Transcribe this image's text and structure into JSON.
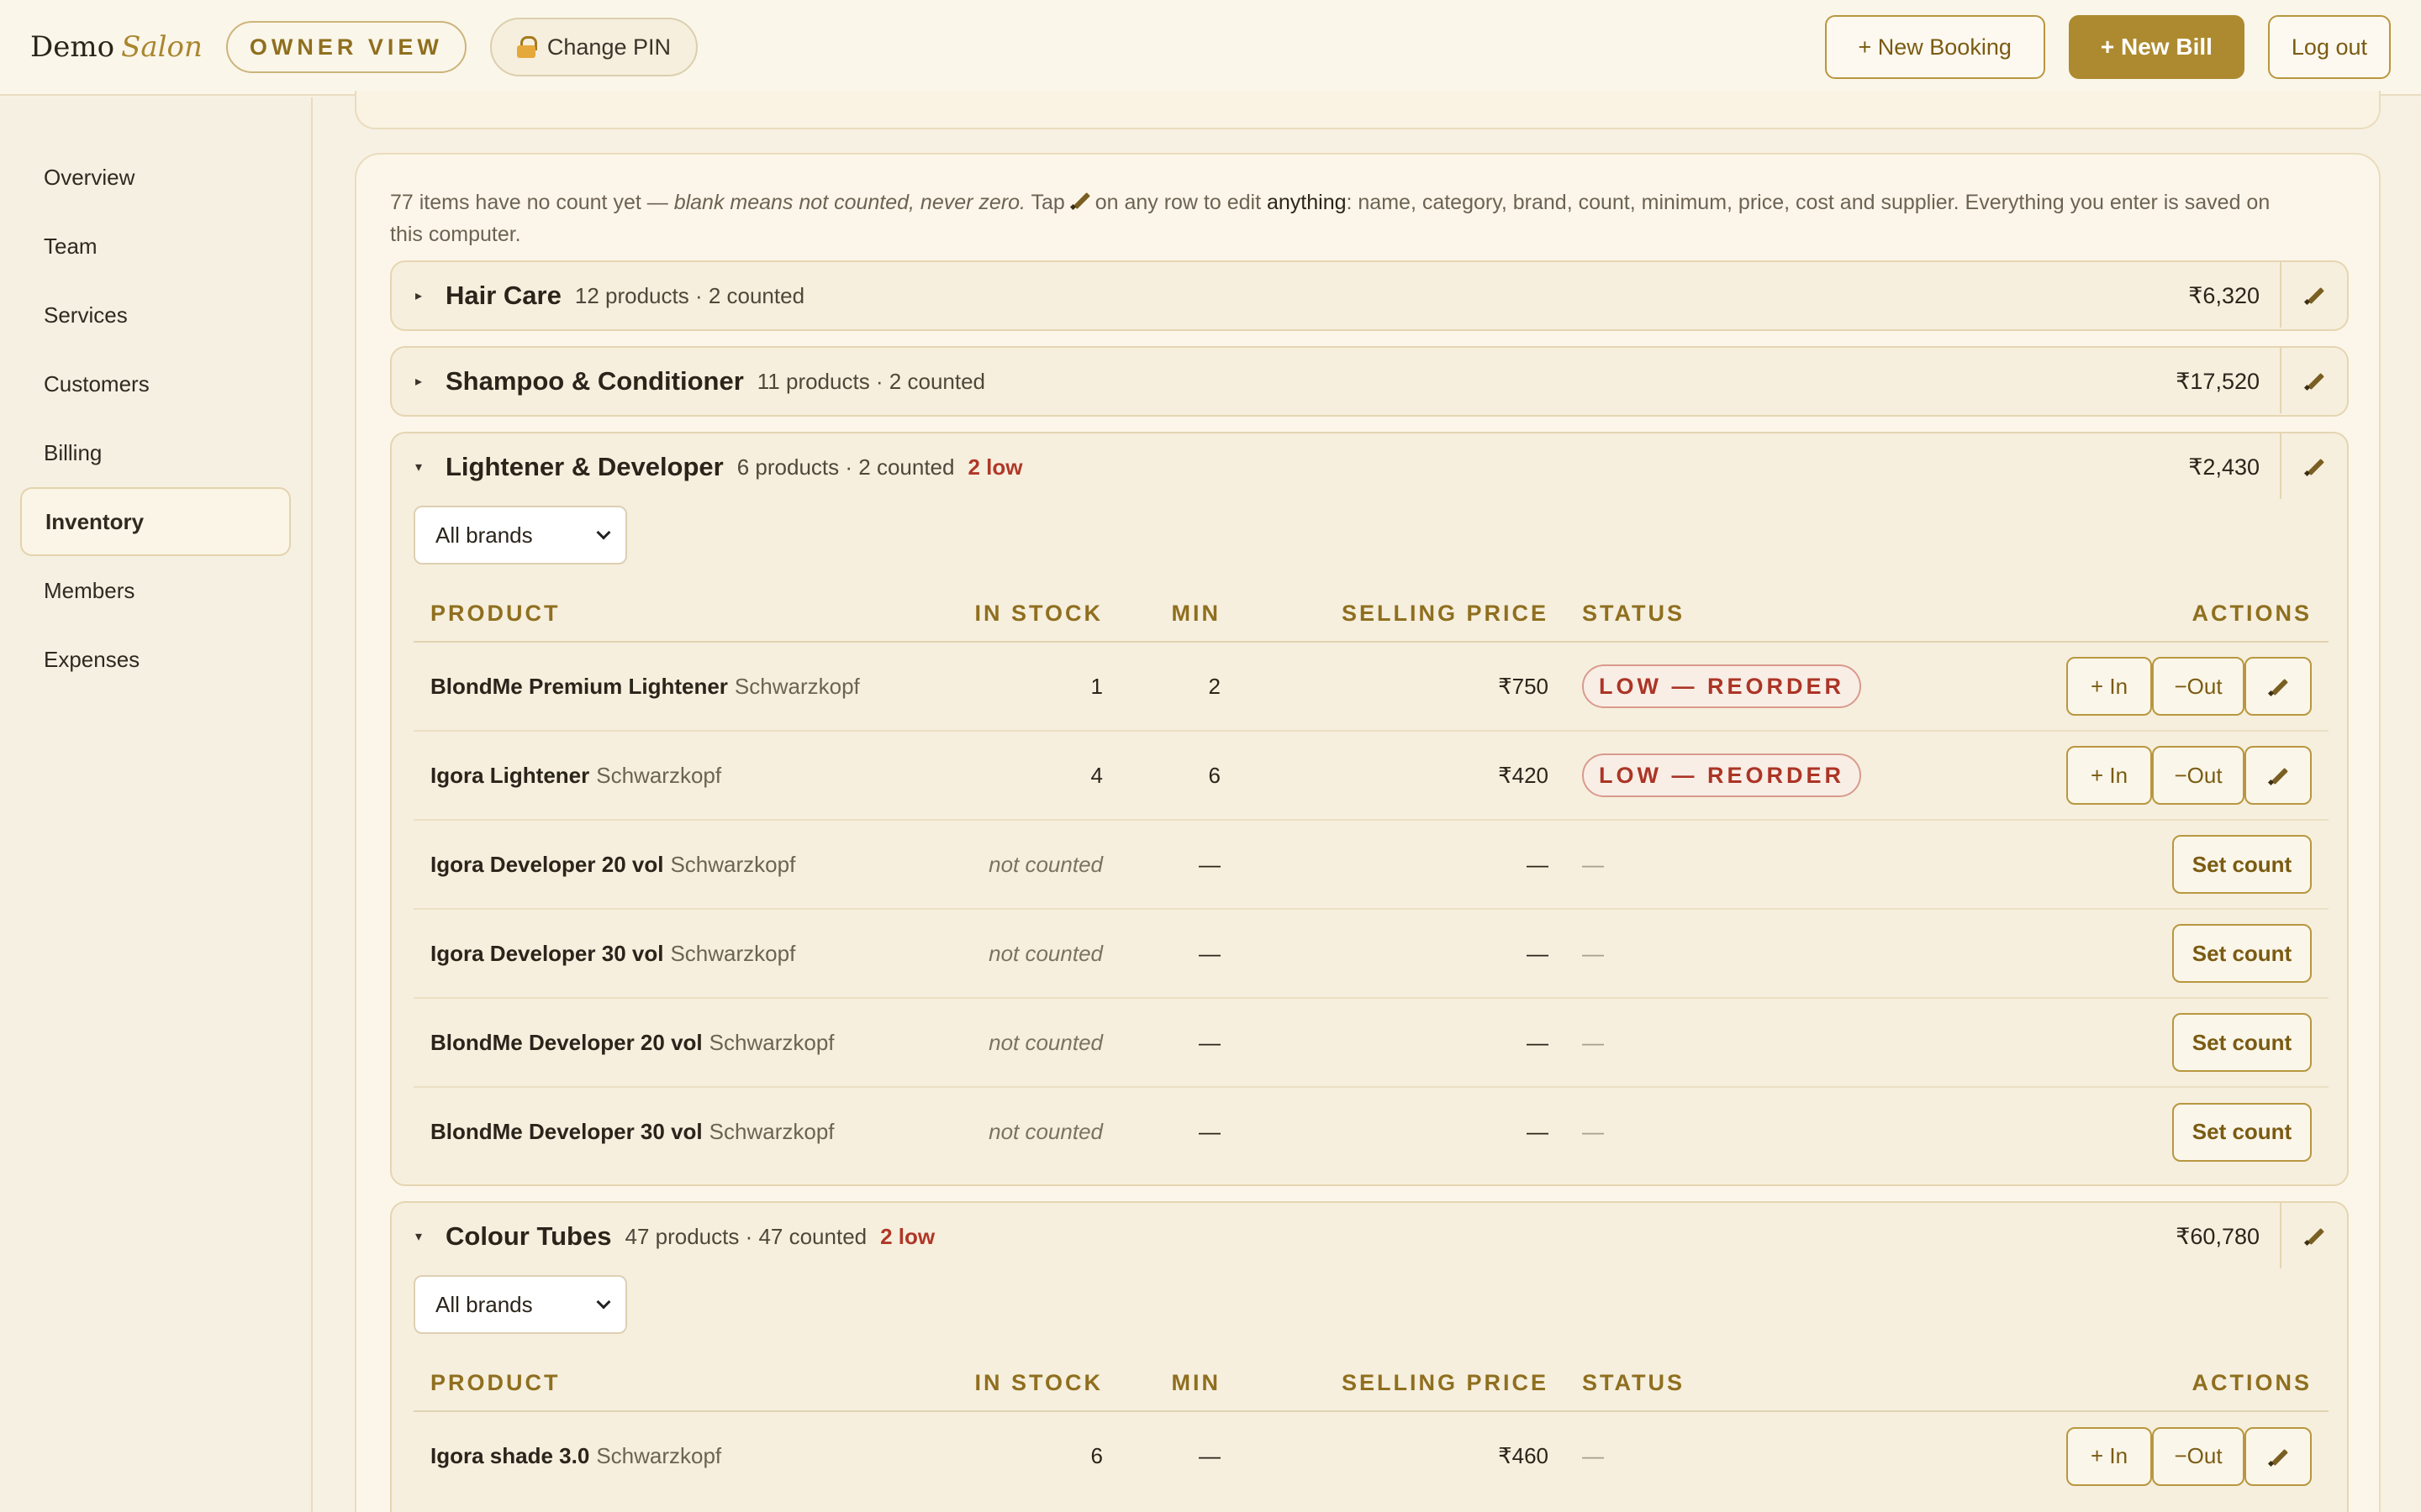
{
  "header": {
    "brand_main": "Demo",
    "brand_accent": "Salon",
    "owner_view": "OWNER VIEW",
    "change_pin": "Change PIN",
    "new_booking": "+ New Booking",
    "new_bill": "+ New Bill",
    "logout": "Log out"
  },
  "sidebar": {
    "items": [
      {
        "label": "Overview"
      },
      {
        "label": "Team"
      },
      {
        "label": "Services"
      },
      {
        "label": "Customers"
      },
      {
        "label": "Billing"
      },
      {
        "label": "Inventory"
      },
      {
        "label": "Members"
      },
      {
        "label": "Expenses"
      }
    ],
    "active": "Inventory"
  },
  "intro": {
    "part1": "77 items have no count yet — ",
    "italic": "blank means not counted, never zero.",
    "part2": " Tap ",
    "part3": " on any row to edit ",
    "bold": "anything",
    "part4": ": name, category, brand, count, minimum, price, cost and supplier. Everything you enter is saved on this computer."
  },
  "groups": [
    {
      "name": "Hair Care",
      "meta": "12 products · 2 counted",
      "low": "",
      "total": "₹6,320"
    },
    {
      "name": "Shampoo & Conditioner",
      "meta": "11 products · 2 counted",
      "low": "",
      "total": "₹17,520"
    },
    {
      "name": "Lightener & Developer",
      "meta": "6 products · 2 counted",
      "low": "2 low",
      "total": "₹2,430"
    },
    {
      "name": "Colour Tubes",
      "meta": "47 products · 47 counted",
      "low": "2 low",
      "total": "₹60,780"
    }
  ],
  "brand_filter": "All brands",
  "columns": {
    "product": "PRODUCT",
    "in_stock": "IN STOCK",
    "min": "MIN",
    "price": "SELLING PRICE",
    "status": "STATUS",
    "actions": "ACTIONS"
  },
  "lightener_rows": [
    {
      "name": "BlondMe Premium Lightener",
      "brand": "Schwarzkopf",
      "stock": "1",
      "min": "2",
      "price": "₹750",
      "status": "LOW — REORDER"
    },
    {
      "name": "Igora Lightener",
      "brand": "Schwarzkopf",
      "stock": "4",
      "min": "6",
      "price": "₹420",
      "status": "LOW — REORDER"
    },
    {
      "name": "Igora Developer 20 vol",
      "brand": "Schwarzkopf",
      "stock": "not counted",
      "min": "—",
      "price": "—",
      "status": "—"
    },
    {
      "name": "Igora Developer 30 vol",
      "brand": "Schwarzkopf",
      "stock": "not counted",
      "min": "—",
      "price": "—",
      "status": "—"
    },
    {
      "name": "BlondMe Developer 20 vol",
      "brand": "Schwarzkopf",
      "stock": "not counted",
      "min": "—",
      "price": "—",
      "status": "—"
    },
    {
      "name": "BlondMe Developer 30 vol",
      "brand": "Schwarzkopf",
      "stock": "not counted",
      "min": "—",
      "price": "—",
      "status": "—"
    }
  ],
  "colour_rows": [
    {
      "name": "Igora shade 3.0",
      "brand": "Schwarzkopf",
      "stock": "6",
      "min": "—",
      "price": "₹460",
      "status": "—"
    }
  ],
  "actions": {
    "in": "+ In",
    "out": "−Out",
    "set_count": "Set count"
  },
  "colors": {
    "accent": "#ad8a2f",
    "low": "#b03828",
    "background": "#f7f1e4"
  }
}
